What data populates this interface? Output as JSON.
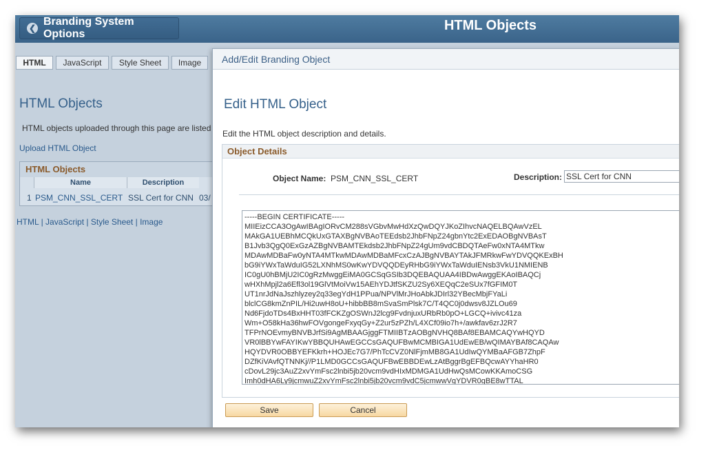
{
  "banner": {
    "back_label": "Branding System Options",
    "title": "HTML Objects"
  },
  "background_page": {
    "tabs": [
      "HTML",
      "JavaScript",
      "Style Sheet",
      "Image"
    ],
    "heading": "HTML Objects",
    "description": "HTML objects uploaded through this page are listed",
    "upload_link": "Upload HTML Object",
    "grid": {
      "title": "HTML Objects",
      "columns": [
        "Name",
        "Description"
      ],
      "row": {
        "num": "1",
        "name": "PSM_CNN_SSL_CERT",
        "description": "SSL Cert for CNN",
        "date": "03/"
      }
    },
    "bottom_links": {
      "html": "HTML",
      "javascript": "JavaScript",
      "stylesheet": "Style Sheet",
      "image": "Image",
      "sep": "|"
    }
  },
  "modal": {
    "title": "Add/Edit Branding Object",
    "heading": "Edit HTML Object",
    "instructions": "Edit the HTML object description and details.",
    "details": {
      "section_title": "Object Details",
      "name_label": "Object Name:",
      "name_value": "PSM_CNN_SSL_CERT",
      "desc_label": "Description:",
      "desc_value": "SSL Cert for CNN",
      "content": "-----BEGIN CERTIFICATE-----\nMIIEizCCA3OgAwIBAgIORvCM288sVGbvMwHdXzQwDQYJKoZIhvcNAQELBQAwVzEL\nMAkGA1UEBhMCQkUxGTAXBgNVBAoTEEdsb2JhbFNpZ24gbnYtc2ExEDAOBgNVBAsT\nB1Jvb3QgQ0ExGzAZBgNVBAMTEkdsb2JhbFNpZ24gUm9vdCBDQTAeFw0xNTA4MTkw\nMDAwMDBaFw0yNTA4MTkwMDAwMDBaMFcxCzAJBgNVBAYTAkJFMRkwFwYDVQQKExBH\nbG9iYWxTaWduIG52LXNhMS0wKwYDVQQDEyRHbG9iYWxTaWduIENsb3VkU1NMIENB\nIC0gU0hBMjU2IC0gRzMwggEiMA0GCSqGSIb3DQEBAQUAA4IBDwAwggEKAoIBAQCj\nwHXhMpjl2a6Efl3ol19GlVtMoiVw15AEhYDJtfSKZU2Sy6XEQqC2eSUx7fGFIM0T\nUT1nrJdNaJszhlyzey2q33egYdH1PPua/NPVlMrJHoAbkJDIrl32YBecMbjFYaLi\nblclCG8kmZnPIL/Hi2uwH8oU+hibbBB8mSvaSmPlsk7C/T4QC0j0dwsv8JZLOu69\nNd6FjdoTDs4BxHHT03fFCKZgOSWnJ2lcg9FvdnjuxURbRb0pO+LGCQ+ivivc41za\nWm+O58kHa36hwFOVgongeFxyqGy+Z2ur5zPZh/L4XCf09io7h+/awkfav6zrJ2R7\nTFPrNOEvmyBNVBJrfSi9AgMBAAGjggFTMIIBTzAOBgNVHQ8BAf8EBAMCAQYwHQYD\nVR0lBBYwFAYIKwYBBQUHAwEGCCsGAQUFBwMCMBIGA1UdEwEB/wQIMAYBAf8CAQAw\nHQYDVR0OBBYEFKkrh+HOJEc7G7/PhTcCVZ0NlFjmMB8GA1UdIwQYMBaAFGB7ZhpF\nDZfKiVAvfQTNNKj//P1LMD0GCCsGAQUFBwEBBDEwLzAtBggrBgEFBQcwAYYhaHR0\ncDovL29jc3AuZ2xvYmFsc2lnbi5jb20vcm9vdHIxMDMGA1UdHwQsMCowKKAmoCSG\nImh0dHA6Ly9jcmwuZ2xvYmFsc2lnbi5jb20vcm9vdC5jcmwwVgYDVR0gBE8wTTAL"
    },
    "buttons": {
      "save": "Save",
      "cancel": "Cancel"
    }
  }
}
